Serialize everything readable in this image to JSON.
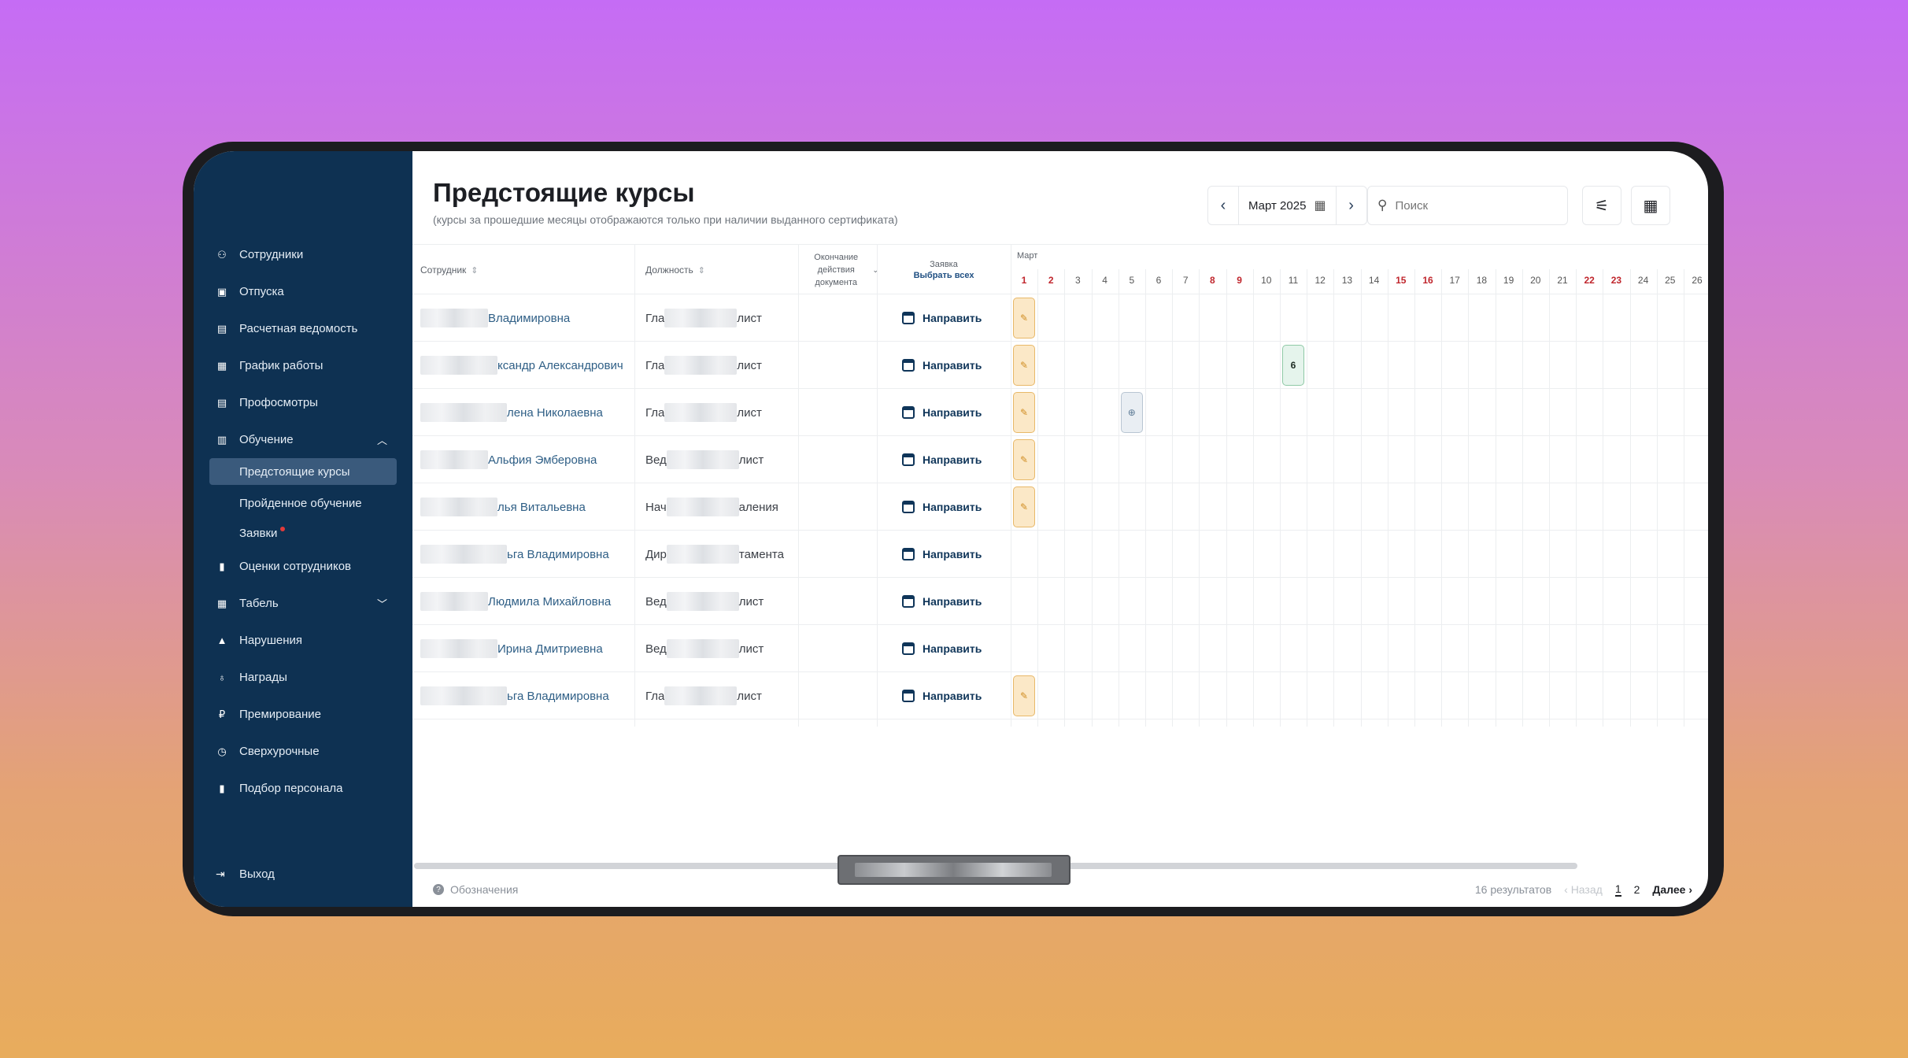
{
  "sidebar": {
    "items": [
      {
        "label": "Сотрудники",
        "icon": "people-icon"
      },
      {
        "label": "Отпуска",
        "icon": "suitcase-icon"
      },
      {
        "label": "Расчетная ведомость",
        "icon": "document-icon"
      },
      {
        "label": "График работы",
        "icon": "calendar-icon"
      },
      {
        "label": "Профосмотры",
        "icon": "clipboard-icon"
      },
      {
        "label": "Обучение",
        "icon": "book-icon"
      }
    ],
    "subitems": [
      "Предстоящие курсы",
      "Пройденное обучение",
      "Заявки"
    ],
    "items2": [
      {
        "label": "Оценки сотрудников",
        "icon": "bar-chart-icon"
      },
      {
        "label": "Табель",
        "icon": "table-icon"
      },
      {
        "label": "Нарушения",
        "icon": "warning-icon"
      },
      {
        "label": "Награды",
        "icon": "medal-icon"
      },
      {
        "label": "Премирование",
        "icon": "ruble-icon"
      },
      {
        "label": "Сверхурочные",
        "icon": "clock-icon"
      },
      {
        "label": "Подбор персонала",
        "icon": "bar-chart-icon"
      }
    ],
    "logout": "Выход"
  },
  "header": {
    "title": "Предстоящие курсы",
    "subtitle": "(курсы за прошедшие месяцы отображаются только при наличии выданного сертификата)",
    "month": "Март 2025",
    "search_placeholder": "Поиск"
  },
  "table": {
    "col_employee": "Сотрудник",
    "col_position": "Должность",
    "col_doc_end": "Окончание действия документа",
    "col_request": "Заявка",
    "select_all": "Выбрать всех",
    "month_label": "Март",
    "days": [
      "1",
      "2",
      "3",
      "4",
      "5",
      "6",
      "7",
      "8",
      "9",
      "10",
      "11",
      "12",
      "13",
      "14",
      "15",
      "16",
      "17",
      "18",
      "19",
      "20",
      "21",
      "22",
      "23",
      "24",
      "25",
      "26"
    ],
    "weekend_days": [
      1,
      2,
      8,
      9,
      15,
      16,
      22,
      23
    ],
    "direct_label": "Направить",
    "rows": [
      {
        "name": "Владимировна",
        "pos_a": "Гла",
        "pos_b": "лист",
        "events": [
          {
            "day": 1,
            "type": "cert"
          }
        ]
      },
      {
        "name": "ксандр Александрович",
        "pos_a": "Гла",
        "pos_b": "лист",
        "events": [
          {
            "day": 1,
            "type": "cert"
          },
          {
            "day": 11,
            "type": "num",
            "text": "6"
          }
        ]
      },
      {
        "name": "лена Николаевна",
        "pos_a": "Гла",
        "pos_b": "лист",
        "events": [
          {
            "day": 1,
            "type": "cert"
          },
          {
            "day": 5,
            "type": "web"
          }
        ]
      },
      {
        "name": "Альфия Эмберовна",
        "pos_a": "Вед",
        "pos_b": "лист",
        "events": [
          {
            "day": 1,
            "type": "cert"
          }
        ]
      },
      {
        "name": "лья Витальевна",
        "pos_a": "Нач",
        "pos_b": "аления",
        "events": [
          {
            "day": 1,
            "type": "cert"
          }
        ]
      },
      {
        "name": "ьга Владимировна",
        "pos_a": "Дир",
        "pos_b": "тамента",
        "events": []
      },
      {
        "name": "Людмила Михайловна",
        "pos_a": "Вед",
        "pos_b": "лист",
        "events": []
      },
      {
        "name": "Ирина Дмитриевна",
        "pos_a": "Вед",
        "pos_b": "лист",
        "events": []
      },
      {
        "name": "ьга Владимировна",
        "pos_a": "Гла",
        "pos_b": "лист",
        "events": [
          {
            "day": 1,
            "type": "cert"
          }
        ]
      }
    ]
  },
  "footer": {
    "legend": "Обозначения",
    "results": "16 результатов",
    "prev": "‹ Назад",
    "pages": [
      "1",
      "2"
    ],
    "next": "Далее ›"
  },
  "colors": {
    "sidebar_bg": "#0e3152",
    "weekend": "#c0262d",
    "link": "#2f5f86",
    "cert": "#fbe8c7"
  }
}
